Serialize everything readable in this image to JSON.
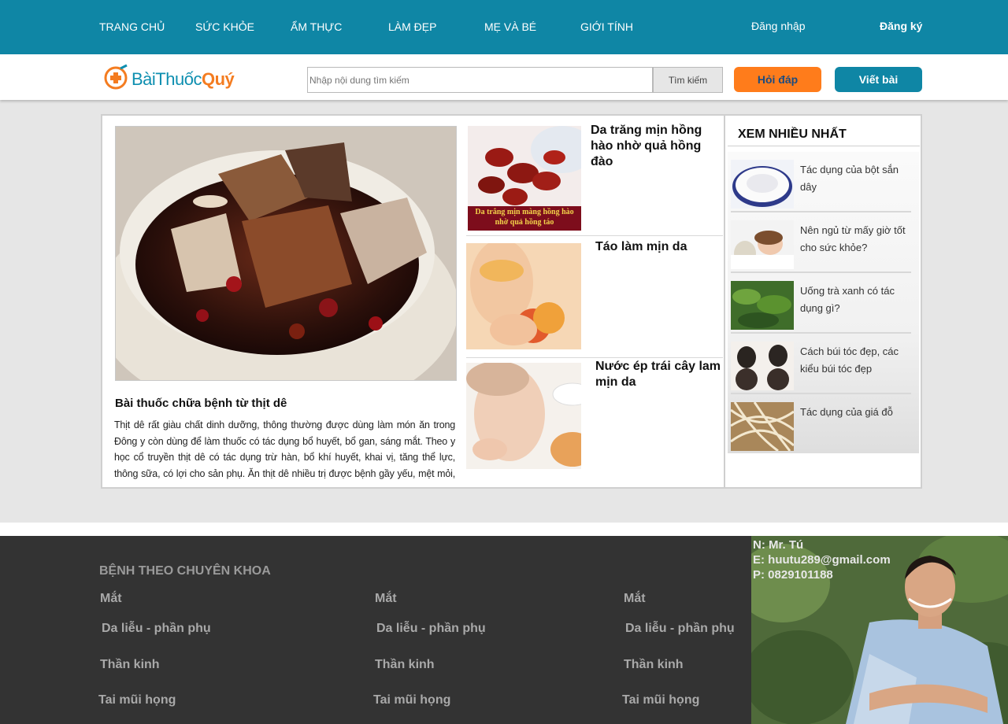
{
  "nav": {
    "items": [
      "TRANG CHỦ",
      "SỨC KHỎE",
      "ẨM THỰC",
      "LÀM ĐẸP",
      "MẸ VÀ BÉ",
      "GIỚI TÍNH"
    ],
    "login": "Đăng nhập",
    "signup": "Đăng ký"
  },
  "header": {
    "logo_part1": "BàiThuốc",
    "logo_part2": "Quý",
    "search_placeholder": "Nhập nội dung tìm kiếm",
    "search_button": "Tìm kiếm",
    "ask_button": "Hỏi đáp",
    "write_button": "Viết bài"
  },
  "featured": {
    "title": "Bài thuốc chữa bệnh từ thịt dê",
    "excerpt": "Thịt dê rất giàu chất dinh dưỡng, thông thường được dùng làm món ăn trong Đông y còn dùng để làm thuốc có tác dụng bổ huyết, bổ gan, sáng mắt. Theo y học cổ truyền thịt dê có tác dụng trừ hàn, bổ khí huyết, khai vị, tăng thể lực, thông sữa, có lợi cho sản phụ. Ăn thịt dê nhiều trị được bệnh gầy yếu, mệt mỏi, nôn ợ,"
  },
  "side_articles": [
    {
      "title": "Da trăng mịn hồng hào nhờ quả hồng đào",
      "image_caption": "Da trắng mịn màng hồng hào nhờ quả hồng táo"
    },
    {
      "title": "Táo làm mịn da"
    },
    {
      "title": "Nước ép trái cây lam mịn da"
    }
  ],
  "popular": {
    "heading": "XEM NHIỀU NHẤT",
    "items": [
      "Tác dụng của bột sắn dây",
      "Nên ngủ từ mấy giờ tốt cho sức khỏe?",
      "Uống trà xanh có tác dụng gì?",
      "Cách búi tóc đẹp, các kiểu búi tóc đẹp",
      "Tác dụng của giá đỗ"
    ]
  },
  "footer": {
    "heading": "BỆNH THEO CHUYÊN KHOA",
    "columns": [
      [
        "Mắt",
        "Da liễu - phần phụ",
        "Thần kinh",
        "Tai mũi họng"
      ],
      [
        "Mắt",
        "Da liễu - phần phụ",
        "Thần kinh",
        "Tai mũi họng"
      ],
      [
        "Mắt",
        "Da liễu - phần phụ",
        "Thần kinh",
        "Tai mũi họng"
      ]
    ],
    "contact": {
      "name": "N: Mr. Tú",
      "email": "E: huutu289@gmail.com",
      "phone": "P: 0829101188"
    }
  },
  "colors": {
    "brand_blue": "#0f86a5",
    "brand_orange": "#ff7c1b",
    "footer_bg": "#333333"
  }
}
